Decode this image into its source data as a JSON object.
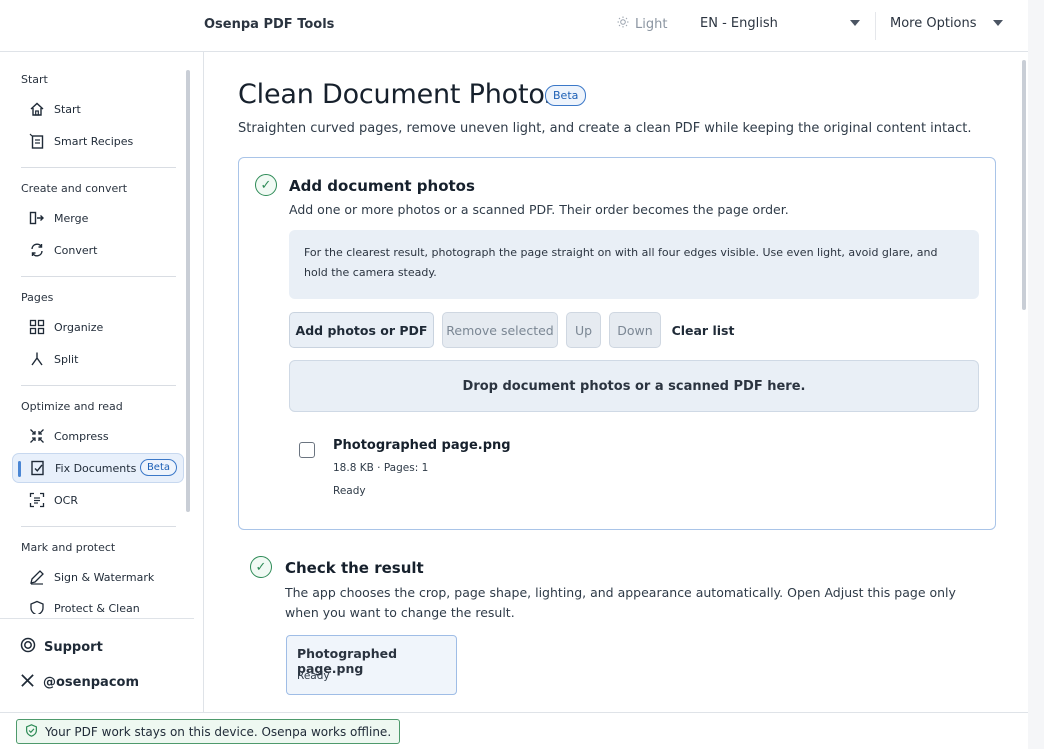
{
  "header": {
    "brand": "Osenpa PDF Tools",
    "theme_label": "Light",
    "language": "EN - English",
    "more_options": "More Options"
  },
  "sidebar": {
    "sections": [
      {
        "title": "Start",
        "items": [
          {
            "label": "Start",
            "icon": "home-icon"
          },
          {
            "label": "Smart Recipes",
            "icon": "recipe-icon"
          }
        ]
      },
      {
        "title": "Create and convert",
        "items": [
          {
            "label": "Merge",
            "icon": "merge-icon"
          },
          {
            "label": "Convert",
            "icon": "convert-icon"
          }
        ]
      },
      {
        "title": "Pages",
        "items": [
          {
            "label": "Organize",
            "icon": "organize-icon"
          },
          {
            "label": "Split",
            "icon": "split-icon"
          }
        ]
      },
      {
        "title": "Optimize and read",
        "items": [
          {
            "label": "Compress",
            "icon": "compress-icon"
          },
          {
            "label": "Fix Documents",
            "icon": "fix-documents-icon",
            "badge": "Beta",
            "active": true
          },
          {
            "label": "OCR",
            "icon": "ocr-icon"
          }
        ]
      },
      {
        "title": "Mark and protect",
        "items": [
          {
            "label": "Sign & Watermark",
            "icon": "sign-icon"
          },
          {
            "label": "Protect & Clean",
            "icon": "protect-icon"
          }
        ]
      }
    ],
    "footer": {
      "support": "Support",
      "social": "@osenpacom"
    }
  },
  "main": {
    "title": "Clean Document Photos",
    "title_badge": "Beta",
    "subtitle": "Straighten curved pages, remove uneven light, and create a clean PDF while keeping the original content intact.",
    "step1": {
      "title": "Add document photos",
      "description": "Add one or more photos or a scanned PDF. Their order becomes the page order.",
      "tip": "For the clearest result, photograph the page straight on with all four edges visible. Use even light, avoid glare, and hold the camera steady.",
      "buttons": {
        "add": "Add photos or PDF",
        "remove": "Remove selected",
        "up": "Up",
        "down": "Down",
        "clear": "Clear list"
      },
      "dropzone": "Drop document photos or a scanned PDF here.",
      "files": [
        {
          "name": "Photographed page.png",
          "meta": "18.8 KB · Pages: 1",
          "status": "Ready"
        }
      ]
    },
    "step2": {
      "title": "Check the result",
      "description": "The app chooses the crop, page shape, lighting, and appearance automatically. Open Adjust this page only when you want to change the result.",
      "result": {
        "name": "Photographed page.png",
        "status": "Ready"
      }
    }
  },
  "footer": {
    "privacy": "Your PDF work stays on this device. Osenpa works offline."
  },
  "colors": {
    "accent": "#3b78c8",
    "success": "#2e8b57",
    "panel": "#e9eff6"
  }
}
